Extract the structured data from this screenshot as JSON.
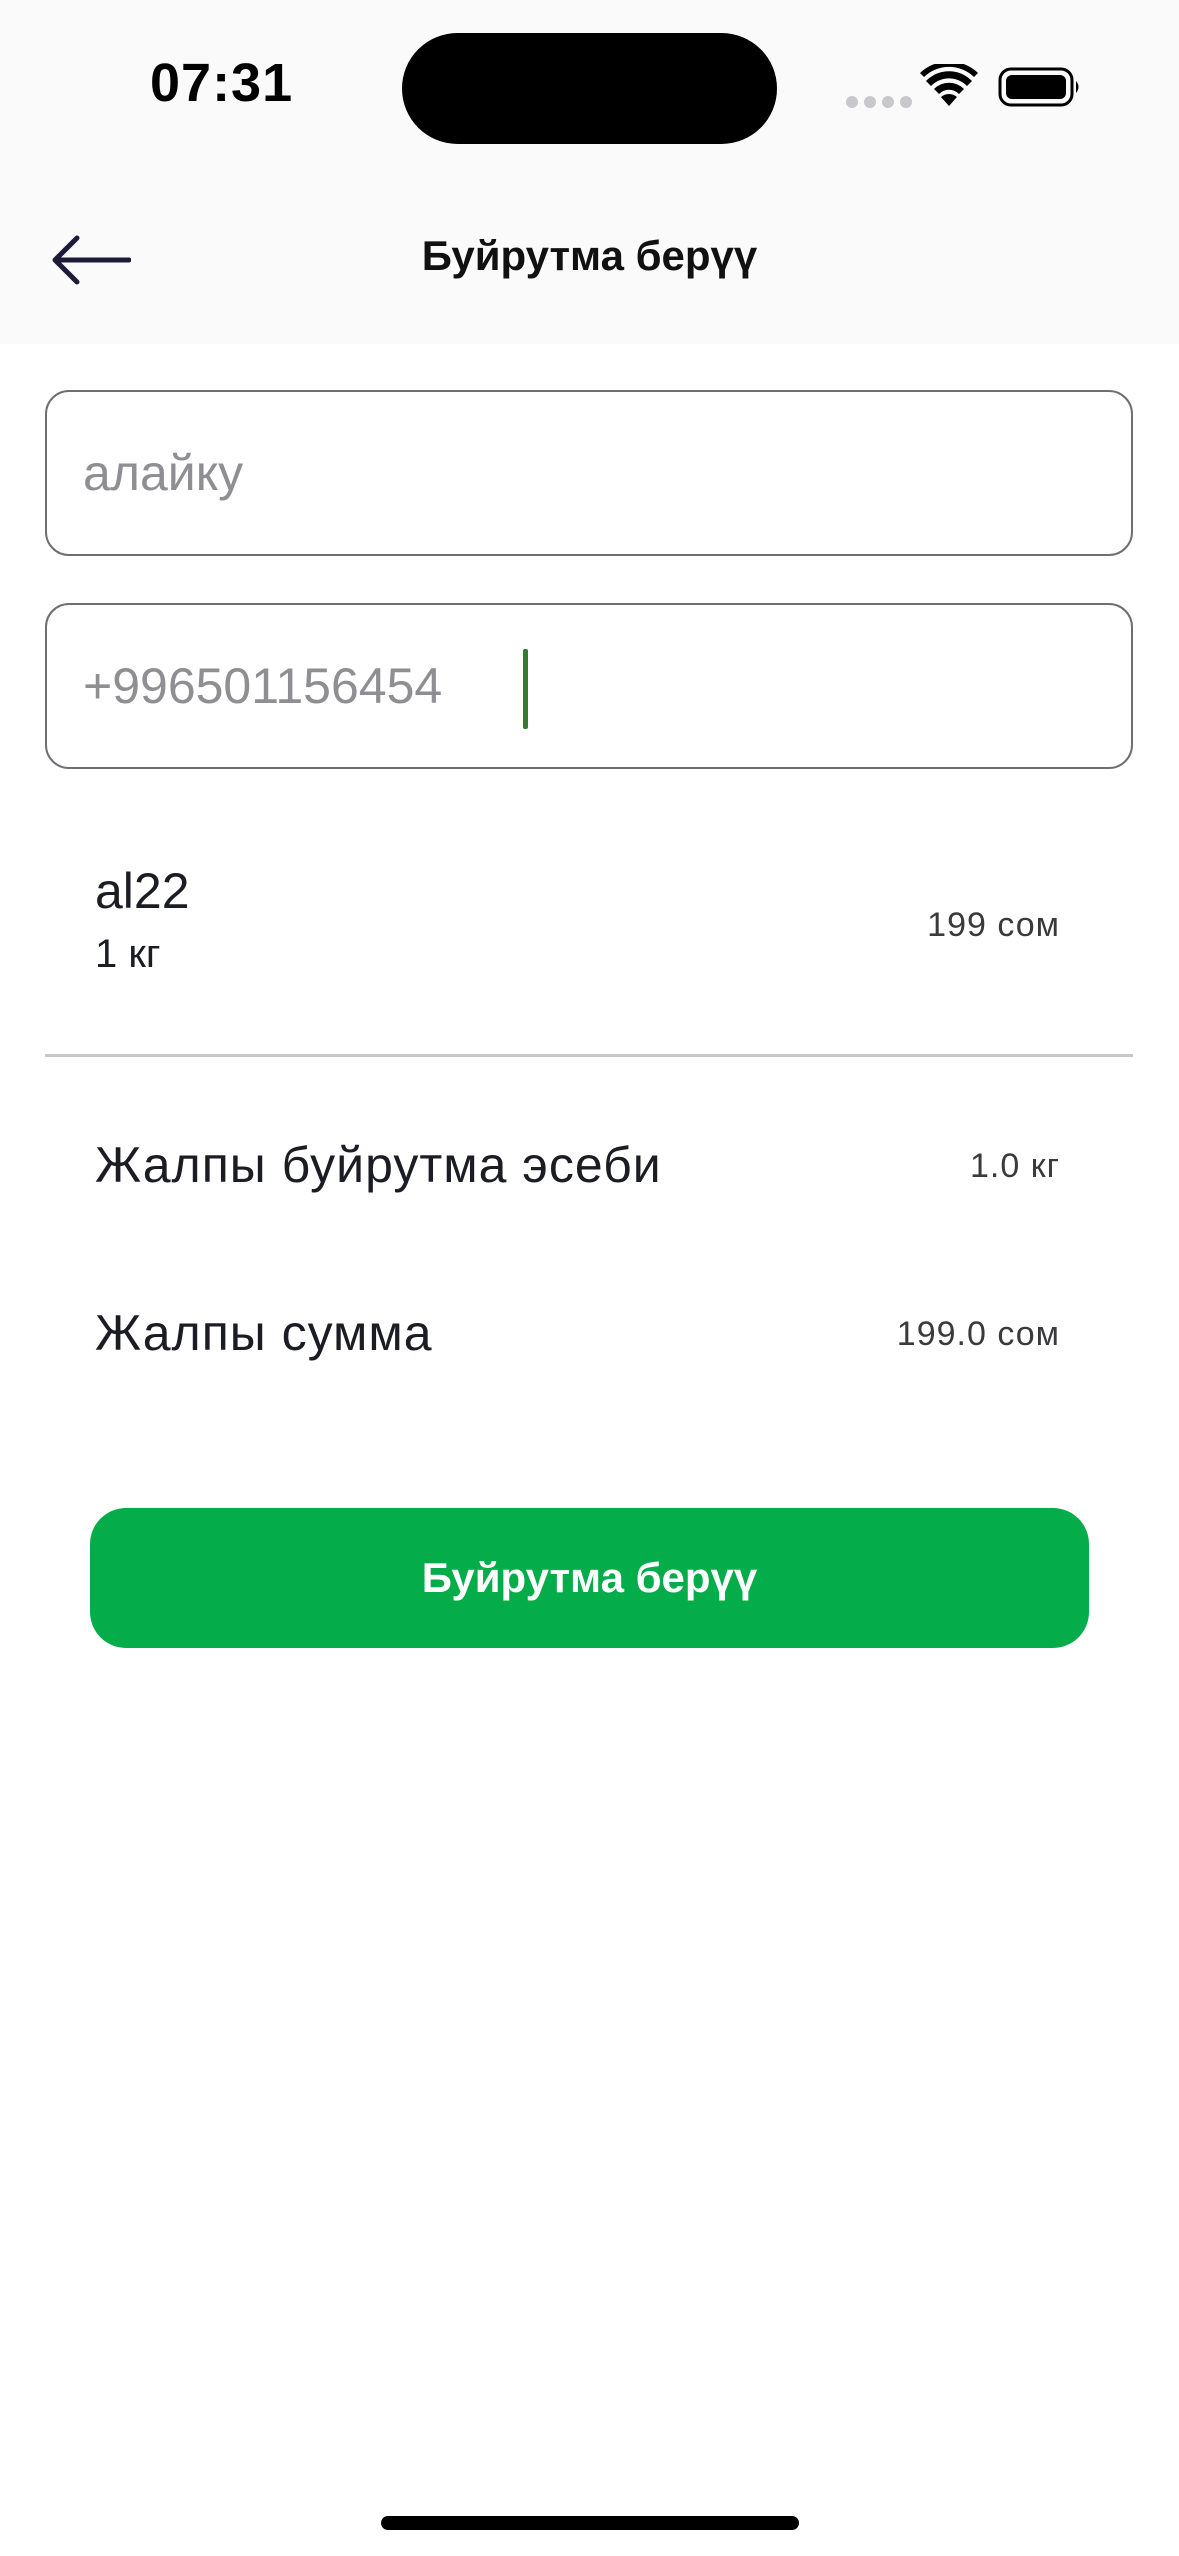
{
  "status_bar": {
    "time": "07:31",
    "wifi_icon": "wifi-icon",
    "battery_icon": "battery-icon"
  },
  "header": {
    "back_icon": "arrow-left-icon",
    "title": "Буйрутма берүү"
  },
  "form": {
    "name_value": "алайку",
    "phone_value": "+996501156454"
  },
  "order_item": {
    "name": "al22",
    "weight": "1 кг",
    "price": "199 сом"
  },
  "summary": {
    "total_count_label": "Жалпы буйрутма эсеби",
    "total_count_value": "1.0 кг",
    "total_sum_label": "Жалпы сумма",
    "total_sum_value": "199.0 сом"
  },
  "submit": {
    "label": "Буйрутма берүү"
  },
  "colors": {
    "accent": "#04ad4a",
    "caret": "#2e7d32",
    "header_bg": "#fafafa"
  }
}
